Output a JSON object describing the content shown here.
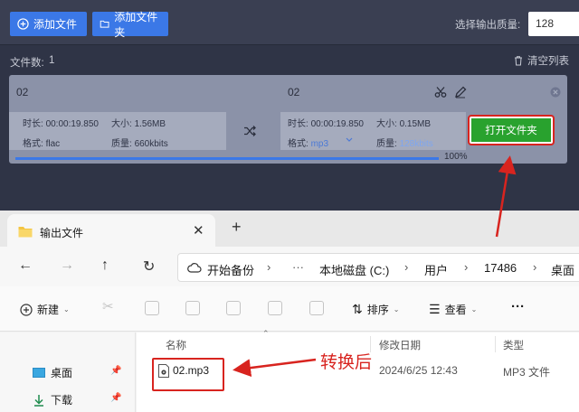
{
  "toolbar": {
    "add_file_label": "添加文件",
    "add_folder_label": "添加文件夹",
    "quality_label": "选择输出质量:",
    "quality_value": "128"
  },
  "list": {
    "file_count_label": "文件数:",
    "file_count": "1",
    "clear_label": "清空列表"
  },
  "file": {
    "source_name": "02",
    "target_name": "02",
    "source": {
      "duration_label": "时长:",
      "duration": "00:00:19.850",
      "size_label": "大小:",
      "size": "1.56MB",
      "format_label": "格式:",
      "format": "flac",
      "quality_label": "质量:",
      "quality": "660kbits"
    },
    "target": {
      "duration_label": "时长:",
      "duration": "00:00:19.850",
      "size_label": "大小:",
      "size": "0.15MB",
      "format_label": "格式:",
      "format": "mp3",
      "quality_label": "质量:",
      "quality": "128kbits"
    },
    "open_folder_label": "打开文件夹",
    "progress": 1.0,
    "progress_text": "100%"
  },
  "explorer": {
    "tab_title": "输出文件",
    "breadcrumbs": [
      "开始备份",
      "本地磁盘 (C:)",
      "用户",
      "17486",
      "桌面"
    ],
    "new_label": "新建",
    "sort_label": "排序",
    "view_label": "查看",
    "more_label": "···",
    "sidebar": [
      "桌面",
      "下载"
    ],
    "columns": [
      "名称",
      "修改日期",
      "类型"
    ],
    "files": [
      {
        "name": "02.mp3",
        "date": "2024/6/25 12:43",
        "type": "MP3 文件"
      }
    ]
  },
  "annotation": {
    "text": "转换后",
    "color": "#d8241f"
  },
  "colors": {
    "accent_blue": "#3b78e7",
    "button_green": "#29a22e",
    "app_bg": "#2f3446"
  }
}
